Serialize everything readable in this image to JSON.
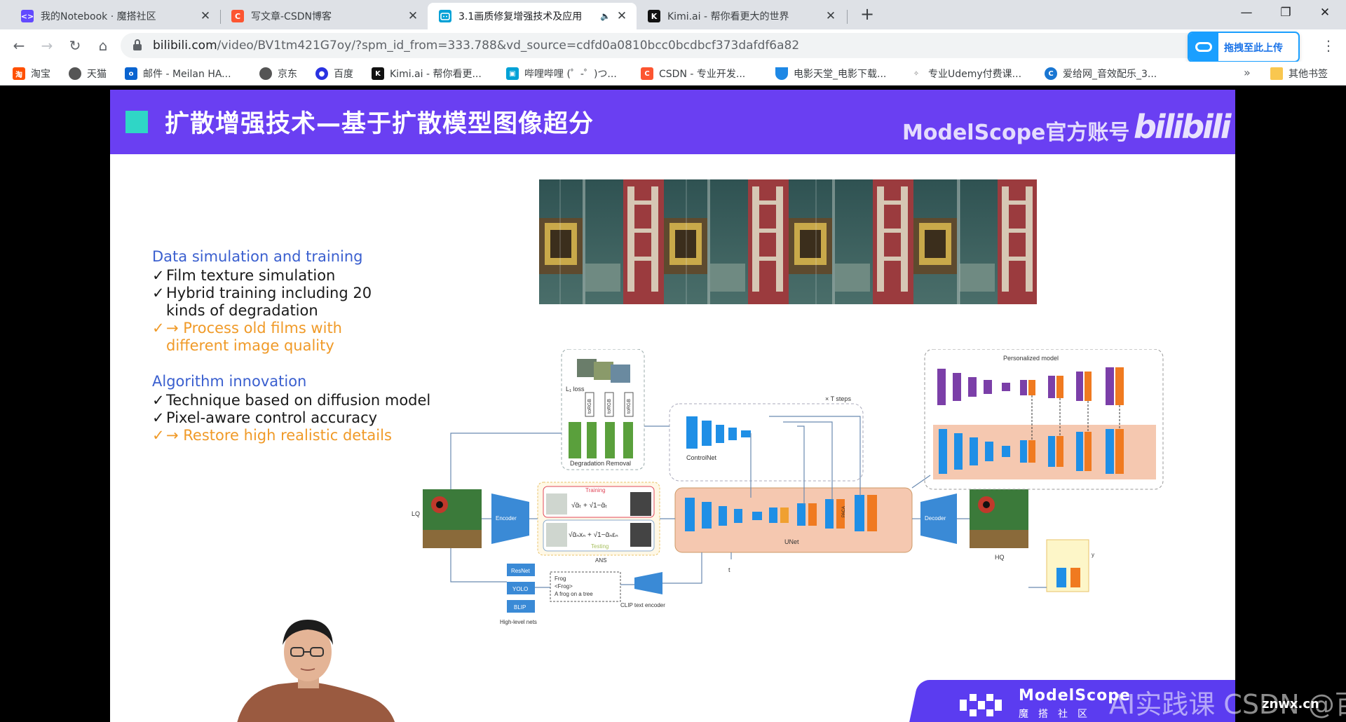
{
  "tabs": [
    {
      "title": "我的Notebook · 魔搭社区",
      "favicon_color": "#624aff"
    },
    {
      "title": "写文章-CSDN博客",
      "favicon_color": "#fc5531",
      "favicon_letter": "C"
    },
    {
      "title": "3.1画质修复增强技术及应用",
      "favicon_color": "#00a1d6",
      "active": true
    },
    {
      "title": "Kimi.ai - 帮你看更大的世界",
      "favicon_color": "#111111",
      "favicon_letter": "K"
    }
  ],
  "address": {
    "host": "bilibili.com",
    "path": "/video/BV1tm421G7oy/?spm_id_from=333.788&vd_source=cdfd0a0810bcc0bcdbcf373dafdf6a82"
  },
  "upload_button": "拖拽至此上传",
  "bookmarks": [
    {
      "label": "淘宝",
      "color": "#ff5000",
      "letter": "淘"
    },
    {
      "label": "天猫",
      "color": "#555555",
      "letter": ""
    },
    {
      "label": "邮件 - Meilan HA...",
      "color": "#0a64d0",
      "letter": "o"
    },
    {
      "label": "京东",
      "color": "#555555",
      "letter": ""
    },
    {
      "label": "百度",
      "color": "#2932e1",
      "letter": "du"
    },
    {
      "label": "Kimi.ai - 帮你看更...",
      "color": "#111111",
      "letter": "K"
    },
    {
      "label": "哔哩哔哩 (゜-゜)つ...",
      "color": "#00a1d6",
      "letter": ""
    },
    {
      "label": "CSDN - 专业开发...",
      "color": "#fc5531",
      "letter": "C"
    },
    {
      "label": "电影天堂_电影下载...",
      "color": "#1e88e5",
      "letter": ""
    },
    {
      "label": "专业Udemy付费课...",
      "color": "#777777",
      "letter": ""
    },
    {
      "label": "爱给网_音效配乐_3...",
      "color": "#1976d2",
      "letter": "C"
    }
  ],
  "bookmarks_more": "»",
  "other_bookmarks": "其他书签",
  "slide": {
    "title": "扩散增强技术—基于扩散模型图像超分",
    "brand": "ModelScope官方账号",
    "bili_logo": "bilibili",
    "section1": "Data simulation and training",
    "s1_items": [
      "Film texture simulation",
      "Hybrid training including 20",
      "kinds of degradation"
    ],
    "s1_highlight": [
      "→ Process old films with",
      "different image quality"
    ],
    "section2": "Algorithm innovation",
    "s2_items": [
      "Technique based on diffusion model",
      "Pixel-aware control accuracy"
    ],
    "s2_highlight": "→ Restore high realistic details",
    "diagram": {
      "personalized": "Personalized model",
      "steps": "× T steps",
      "l1": "L₁ loss",
      "toRGB": "toRGB",
      "degradation_removal": "Degradation Removal",
      "controlnet": "ControlNet",
      "training": "Training",
      "testing": "Testing",
      "ans": "ANS",
      "unet": "UNet",
      "encoder": "Encoder",
      "decoder": "Decoder",
      "lq": "LQ",
      "hq": "HQ",
      "resnet": "ResNet",
      "yolo": "YOLO",
      "blip": "BLIP",
      "highlevel": "High-level nets",
      "prompt_lines": [
        "Frog",
        "<Frog>",
        "A frog on a tree"
      ],
      "clip": "CLIP text encoder",
      "paca": "PACA",
      "t": "t",
      "y": "y"
    },
    "footer_brand": "ModelScope",
    "footer_sub": "魔搭社区",
    "watermark": "AI实践课 CSDN @百里香酚兰",
    "watermark2": "znwx.cn"
  }
}
